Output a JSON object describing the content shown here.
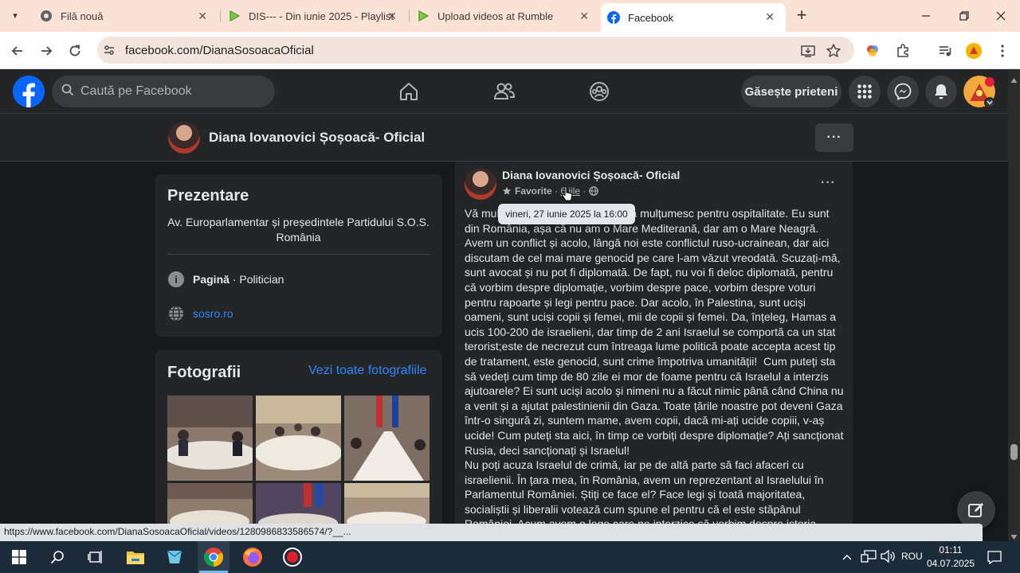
{
  "browser": {
    "tabs": [
      {
        "title": "Filă nouă",
        "icon": "chrome-icon"
      },
      {
        "title": "DIS--- - Din iunie 2025 - Playlist",
        "icon": "rumble-icon"
      },
      {
        "title": "Upload videos at Rumble",
        "icon": "rumble-icon"
      },
      {
        "title": "Facebook",
        "icon": "facebook-icon",
        "active": true
      }
    ],
    "url": "facebook.com/DianaSosoacaOficial",
    "status_link": "https://www.facebook.com/DianaSosoacaOficial/videos/1280986833586574/?__..."
  },
  "fb": {
    "search_placeholder": "Caută pe Facebook",
    "find_friends": "Găsește prieteni",
    "notification_color": "#e41e3f"
  },
  "page": {
    "name": "Diana Iovanovici Șoșoacă- Oficial"
  },
  "intro": {
    "title": "Prezentare",
    "bio": "Av. Europarlamentar și președintele Partidului S.O.S. România",
    "category_label": "Pagină",
    "category_sep": " · ",
    "category_value": "Politician",
    "website": "sosro.ro"
  },
  "photos": {
    "title": "Fotografii",
    "see_all": "Vezi toate fotografiile"
  },
  "post": {
    "author": "Diana Iovanovici Șoșoacă- Oficial",
    "meta_favorite": "Favorite",
    "meta_sep": " · ",
    "meta_time": "6 iile",
    "tooltip": "vineri, 27 iunie 2025 la 16:00",
    "text": "Vă mulțumesc pentru invitație și vă mulțumesc pentru ospitalitate. Eu sunt din România, așa că nu am o Mare Mediterană, dar am o Mare Neagră. Avem un conflict și acolo, lângă noi este conflictul ruso-ucrainean, dar aici discutam de cel mai mare genocid pe care l-am văzut vreodată. Scuzați-mă, sunt avocat și nu pot fi diplomată. De fapt, nu voi fi deloc diplomată, pentru că vorbim despre diplomație, vorbim despre pace, vorbim despre voturi pentru rapoarte și legi pentru pace. Dar acolo, în Palestina, sunt uciși oameni, sunt uciși copii și femei, mii de copii și femei. Da, înțeleg, Hamas a ucis 100-200 de israelieni, dar timp de 2 ani Israelul se comportă ca un stat terorist;este de necrezut cum întreaga lume politică poate accepta acest tip de tratament, este genocid, sunt crime împotriva umanității!  Cum puteți sta să vedeți cum timp de 80 zile ei mor de foame pentru că Israelul a interzis ajutoarele? Ei sunt uciși acolo și nimeni nu a făcut nimic până când China nu a venit și a ajutat palestinienii din Gaza. Toate țările noastre pot deveni Gaza într-o singură zi, suntem mame, avem copii, dacă mi-ați ucide copiii, v-aș ucide! Cum puteți sta aici, în timp ce vorbiți despre diplomație? Ați sancționat Rusia, deci sancționați și Israelul!\nNu poți acuza Israelul de crimă, iar pe de altă parte să faci afaceri cu israelienii. În țara mea, în România, avem un reprezentant al Israelului în Parlamentul României. Știți ce face el? Face legi și toată majoritatea, socialiștii și liberalii votează cum spune el pentru că el este stăpânul României. Acum avem o lege care ne interzice să vorbim despre istoria României, doar"
  },
  "taskbar": {
    "lang": "ROU",
    "time": "01:11",
    "date": "04.07.2025"
  }
}
